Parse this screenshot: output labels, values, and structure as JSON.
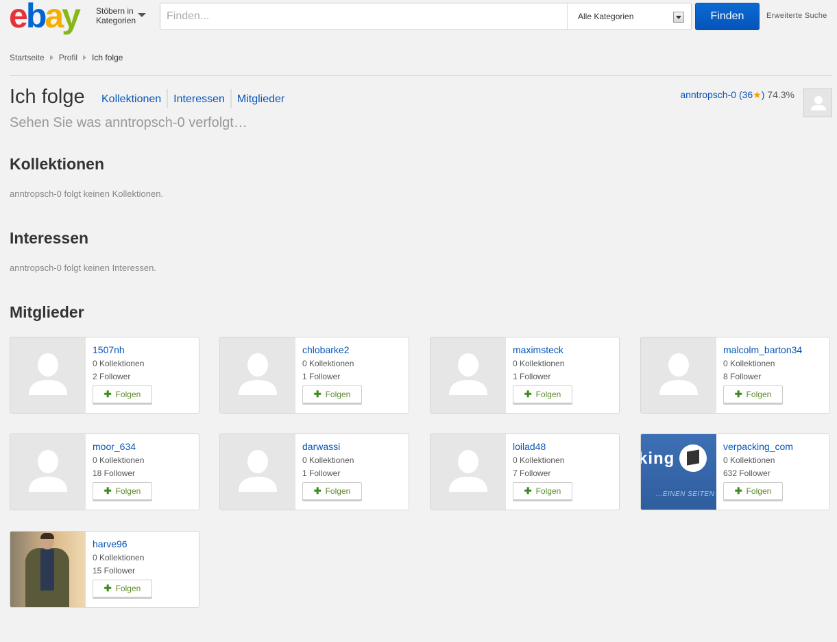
{
  "header": {
    "logo_letters": [
      "e",
      "b",
      "a",
      "y"
    ],
    "logo_colors": [
      "#e53238",
      "#0064d2",
      "#f5af02",
      "#86b817"
    ],
    "browse_label_line1": "Stöbern in",
    "browse_label_line2": "Kategorien",
    "search_placeholder": "Finden...",
    "category_selected": "Alle Kategorien",
    "find_button": "Finden",
    "advanced_search": "Erweiterte Suche"
  },
  "breadcrumb": [
    "Startseite",
    "Profil",
    "Ich folge"
  ],
  "title": {
    "heading": "Ich folge",
    "tabs": [
      "Kollektionen",
      "Interessen",
      "Mitglieder"
    ],
    "subtitle": "Sehen Sie was anntropsch-0 verfolgt…"
  },
  "user": {
    "name": "anntropsch-0",
    "score_open": "(36",
    "star": "★",
    "score_close": ")",
    "percent": "74.3%"
  },
  "sections": {
    "collections_title": "Kollektionen",
    "collections_note": "anntropsch-0 folgt keinen Kollektionen.",
    "interests_title": "Interessen",
    "interests_note": "anntropsch-0 folgt keinen Interessen.",
    "members_title": "Mitglieder"
  },
  "follow_label": "Folgen",
  "members": [
    {
      "name": "1507nh",
      "collections": "0 Kollektionen",
      "followers": "2 Follower",
      "image": "placeholder"
    },
    {
      "name": "chlobarke2",
      "collections": "0 Kollektionen",
      "followers": "1 Follower",
      "image": "placeholder"
    },
    {
      "name": "maximsteck",
      "collections": "0 Kollektionen",
      "followers": "1 Follower",
      "image": "placeholder"
    },
    {
      "name": "malcolm_barton34",
      "collections": "0 Kollektionen",
      "followers": "8 Follower",
      "image": "placeholder"
    },
    {
      "name": "moor_634",
      "collections": "0 Kollektionen",
      "followers": "18 Follower",
      "image": "placeholder"
    },
    {
      "name": "darwassi",
      "collections": "0 Kollektionen",
      "followers": "1 Follower",
      "image": "placeholder"
    },
    {
      "name": "loilad48",
      "collections": "0 Kollektionen",
      "followers": "7 Follower",
      "image": "placeholder"
    },
    {
      "name": "verpacking_com",
      "collections": "0 Kollektionen",
      "followers": "632 Follower",
      "image": "brand",
      "image_text1": "king",
      "image_text2": "...EINEN SEITEN"
    },
    {
      "name": "harve96",
      "collections": "0 Kollektionen",
      "followers": "15 Follower",
      "image": "photo"
    }
  ]
}
